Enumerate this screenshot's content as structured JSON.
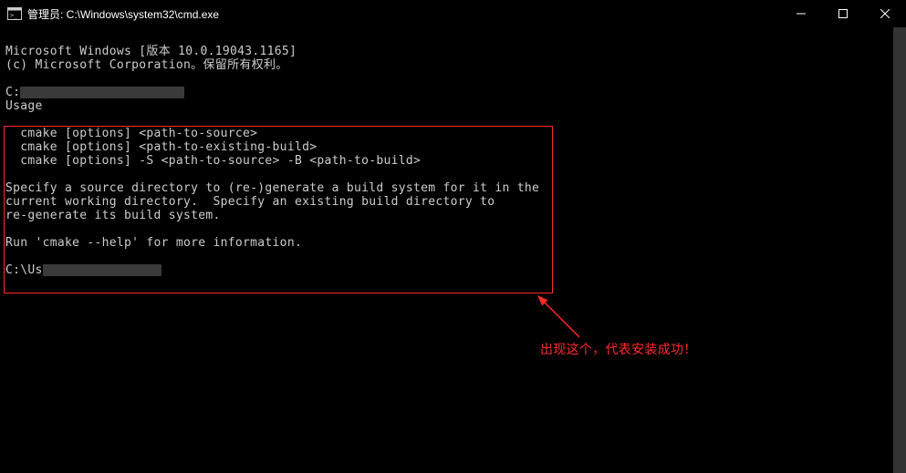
{
  "window": {
    "title": "管理员: C:\\Windows\\system32\\cmd.exe"
  },
  "terminal": {
    "line1": "Microsoft Windows [版本 10.0.19043.1165]",
    "line2": "(c) Microsoft Corporation。保留所有权利。",
    "prompt1_prefix": "C:",
    "usage_header": "Usage",
    "usage1": "  cmake [options] <path-to-source>",
    "usage2": "  cmake [options] <path-to-existing-build>",
    "usage3": "  cmake [options] -S <path-to-source> -B <path-to-build>",
    "desc1": "Specify a source directory to (re-)generate a build system for it in the",
    "desc2": "current working directory.  Specify an existing build directory to",
    "desc3": "re-generate its build system.",
    "runhelp": "Run 'cmake --help' for more information.",
    "prompt2_prefix": "C:\\Us"
  },
  "annotation": {
    "text": "出现这个，代表安装成功！"
  }
}
